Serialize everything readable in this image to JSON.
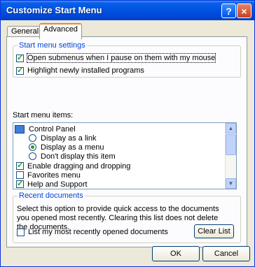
{
  "window": {
    "title": "Customize Start Menu",
    "help_icon": "?",
    "close_icon": "×"
  },
  "tabs": [
    {
      "label": "General"
    },
    {
      "label": "Advanced"
    }
  ],
  "start_menu_settings": {
    "caption": "Start menu settings",
    "open_submenus": {
      "label": "Open submenus when I pause on them with my mouse",
      "checked": true
    },
    "highlight": {
      "label": "Highlight newly installed programs",
      "checked": true
    }
  },
  "start_menu_items": {
    "label": "Start menu items:",
    "items": [
      {
        "label": "Control Panel",
        "type": "folder"
      },
      {
        "label": "Display as a link",
        "type": "radio",
        "selected": false
      },
      {
        "label": "Display as a menu",
        "type": "radio",
        "selected": true
      },
      {
        "label": "Don't display this item",
        "type": "radio",
        "selected": false
      },
      {
        "label": "Enable dragging and dropping",
        "type": "checkbox",
        "checked": true
      },
      {
        "label": "Favorites menu",
        "type": "checkbox",
        "checked": false
      },
      {
        "label": "Help and Support",
        "type": "checkbox",
        "checked": true
      }
    ]
  },
  "recent_documents": {
    "caption": "Recent documents",
    "description": "Select this option to provide quick access to the documents you opened most recently. Clearing this list does not delete the documents.",
    "list_recent": {
      "label": "List my most recently opened documents",
      "checked": false
    },
    "clear_list": "Clear List"
  },
  "buttons": {
    "ok": "OK",
    "cancel": "Cancel"
  }
}
